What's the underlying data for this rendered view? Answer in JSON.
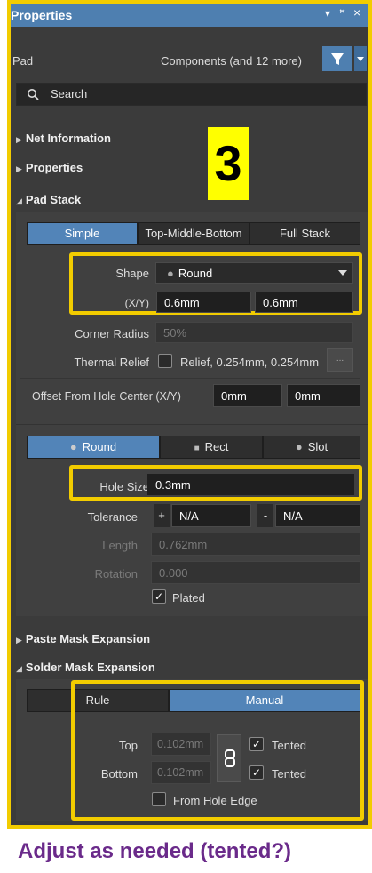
{
  "panel": {
    "title": "Properties",
    "controls": [
      "▾",
      "ꟸ",
      "×"
    ],
    "object_type": "Pad",
    "filter_text": "Components (and 12 more)",
    "search_placeholder": "Search"
  },
  "sections": {
    "net_info": "Net Information",
    "properties": "Properties",
    "pad_stack": "Pad Stack",
    "paste_mask": "Paste Mask Expansion",
    "solder_mask": "Solder Mask Expansion"
  },
  "stack_tabs": [
    "Simple",
    "Top-Middle-Bottom",
    "Full Stack"
  ],
  "shape": {
    "label": "Shape",
    "value": "Round",
    "xy_label": "(X/Y)",
    "x": "0.6mm",
    "y": "0.6mm"
  },
  "corner_radius": {
    "label": "Corner Radius",
    "value": "50%"
  },
  "thermal_relief": {
    "label": "Thermal Relief",
    "value": "Relief, 0.254mm, 0.254mm",
    "more": "..."
  },
  "offset": {
    "label": "Offset From Hole Center (X/Y)",
    "x": "0mm",
    "y": "0mm"
  },
  "hole_tabs": [
    "Round",
    "Rect",
    "Slot"
  ],
  "hole": {
    "size_label": "Hole Size",
    "size": "0.3mm",
    "tol_label": "Tolerance",
    "tol_plus": "+",
    "tol_plus_val": "N/A",
    "tol_minus": "-",
    "tol_minus_val": "N/A",
    "length_label": "Length",
    "length": "0.762mm",
    "rotation_label": "Rotation",
    "rotation": "0.000",
    "plated_label": "Plated",
    "plated": true
  },
  "solder": {
    "tabs": [
      "Rule",
      "Manual"
    ],
    "top_label": "Top",
    "top_val": "0.102mm",
    "bottom_label": "Bottom",
    "bottom_val": "0.102mm",
    "tented_label": "Tented",
    "from_hole_edge": "From Hole Edge"
  },
  "annotation": {
    "step": "3",
    "caption": "Adjust as needed (tented?)"
  },
  "colors": {
    "accent": "#4e7fb0",
    "highlight": "#f2cc00",
    "caption": "#6a2a8a"
  }
}
